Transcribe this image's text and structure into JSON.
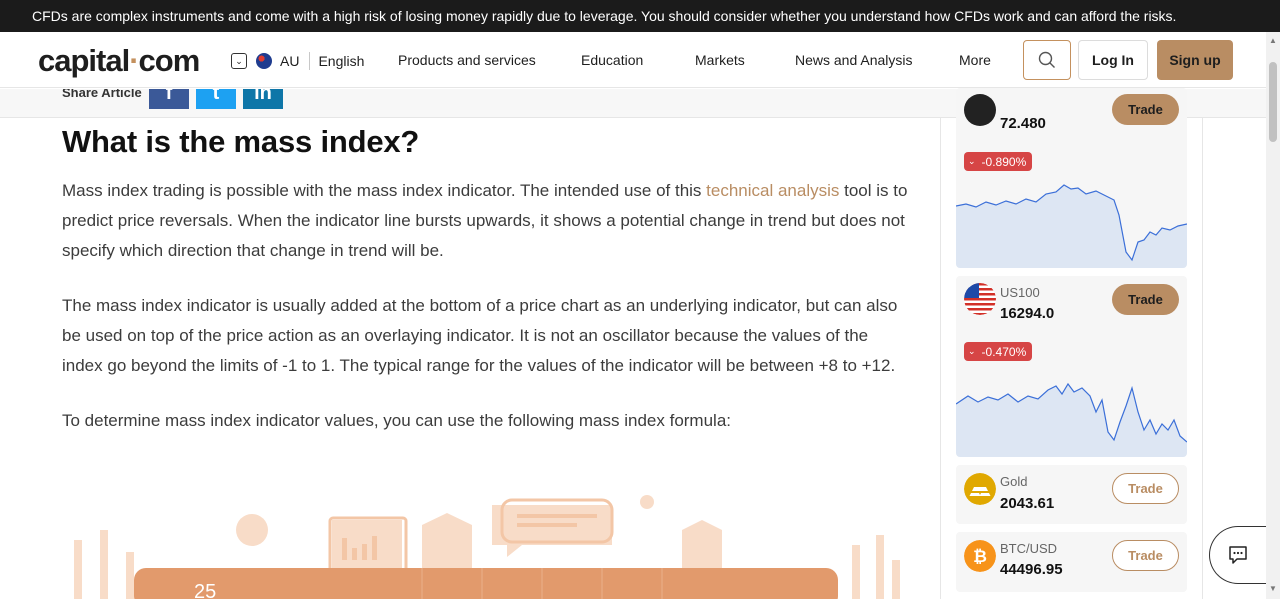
{
  "risk_warning": "CFDs are complex instruments and come with a high risk of losing money rapidly due to leverage. You should consider whether you understand how CFDs work and can afford the risks.",
  "header": {
    "logo_text": "capital",
    "logo_dot": "·",
    "logo_suffix": "com",
    "region": "AU",
    "language": "English",
    "nav": [
      "Products and services",
      "Education",
      "Markets",
      "News and Analysis",
      "More"
    ],
    "login_label": "Log In",
    "signup_label": "Sign up"
  },
  "share": {
    "label": "Share Article",
    "networks": [
      "f",
      "t",
      "in"
    ]
  },
  "article": {
    "heading": "What is the mass index?",
    "p1_before": "Mass index trading is possible with the mass index indicator. The intended use of this ",
    "p1_link": "technical analysis",
    "p1_after": " tool is to predict price reversals. When the indicator line bursts upwards, it shows a potential change in trend but does not specify which direction that change in trend will be.",
    "p2": "The mass index indicator is usually added at the bottom of a price chart as an underlying  indicator, but can also be used on top of the price action as an overlaying indicator. It is not an oscillator because the values of the index go beyond the limits of -1 to 1. The typical range for the values of the indicator will be between +8 to +12.",
    "p3": "To determine mass index indicator values, you can use the following mass index formula:",
    "illustration_number": "25"
  },
  "markets": [
    {
      "symbol": "",
      "price": "72.480",
      "change": "-0.890%",
      "trade_label": "Trade"
    },
    {
      "symbol": "US100",
      "price": "16294.0",
      "change": "-0.470%",
      "trade_label": "Trade"
    },
    {
      "symbol": "Gold",
      "price": "2043.61",
      "trade_label": "Trade"
    },
    {
      "symbol": "BTC/USD",
      "price": "44496.95",
      "trade_label": "Trade"
    }
  ],
  "colors": {
    "accent": "#b98d63",
    "negative": "#d64545",
    "risk_bar": "#1b1b1b"
  }
}
